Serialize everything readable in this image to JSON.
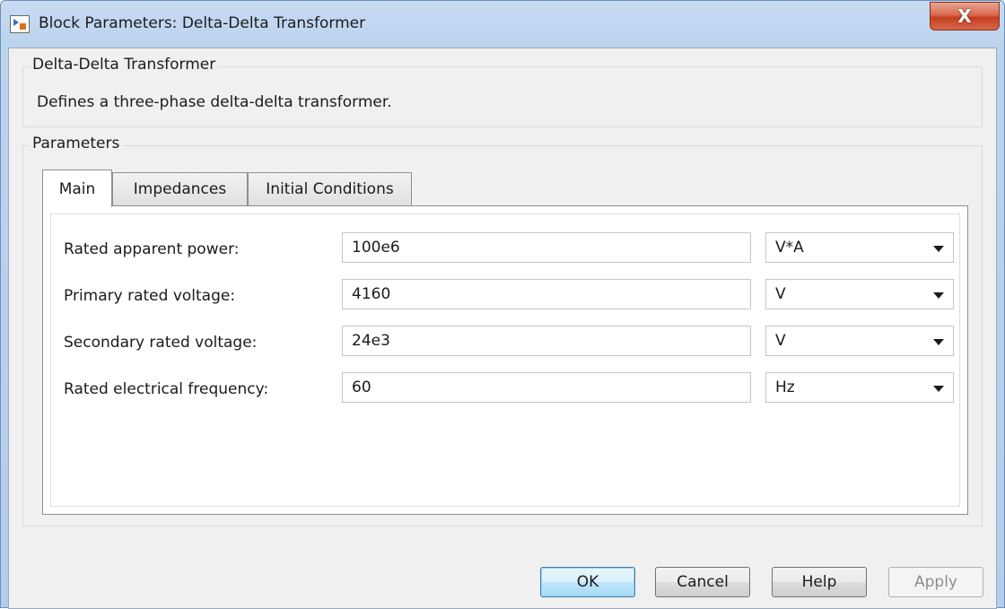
{
  "window": {
    "title": "Block Parameters: Delta-Delta Transformer",
    "close_glyph": "X"
  },
  "block": {
    "name": "Delta-Delta Transformer",
    "description": "Defines a three-phase delta-delta transformer."
  },
  "parameters": {
    "legend": "Parameters",
    "tabs": [
      {
        "label": "Main",
        "active": true
      },
      {
        "label": "Impedances",
        "active": false
      },
      {
        "label": "Initial Conditions",
        "active": false
      }
    ],
    "rows": [
      {
        "label": "Rated apparent power:",
        "value": "100e6",
        "unit": "V*A"
      },
      {
        "label": "Primary rated voltage:",
        "value": "4160",
        "unit": "V"
      },
      {
        "label": "Secondary rated voltage:",
        "value": "24e3",
        "unit": "V"
      },
      {
        "label": "Rated electrical frequency:",
        "value": "60",
        "unit": "Hz"
      }
    ]
  },
  "buttons": {
    "ok": "OK",
    "cancel": "Cancel",
    "help": "Help",
    "apply": "Apply"
  },
  "colors": {
    "title_bar": "#bcd3ee",
    "close_button": "#c43e1f",
    "dialog_bg": "#f0f0f0",
    "default_button": "#bee6fd"
  }
}
